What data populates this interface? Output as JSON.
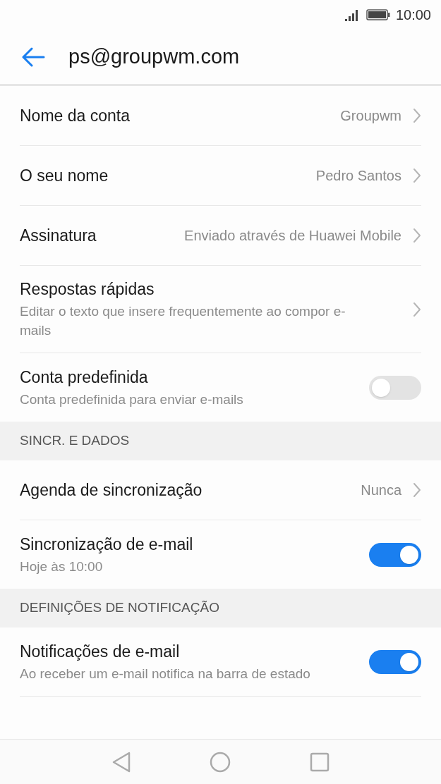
{
  "status_bar": {
    "time": "10:00"
  },
  "header": {
    "title": "ps@groupwm.com"
  },
  "sections": [
    {
      "items": [
        {
          "kind": "chevron",
          "title": "Nome da conta",
          "value": "Groupwm"
        },
        {
          "kind": "chevron",
          "title": "O seu nome",
          "value": "Pedro Santos"
        },
        {
          "kind": "chevron",
          "title": "Assinatura",
          "value": "Enviado através de Huawei Mobile"
        },
        {
          "kind": "chevron",
          "title": "Respostas rápidas",
          "subtitle": "Editar o texto que insere frequentemente ao compor e-mails"
        },
        {
          "kind": "switch",
          "title": "Conta predefinida",
          "subtitle": "Conta predefinida para enviar e-mails",
          "on": false
        }
      ]
    },
    {
      "heading": "SINCR. E DADOS",
      "items": [
        {
          "kind": "chevron",
          "title": "Agenda de sincronização",
          "value": "Nunca"
        },
        {
          "kind": "switch",
          "title": "Sincronização de e-mail",
          "subtitle": "Hoje às 10:00",
          "on": true
        }
      ]
    },
    {
      "heading": "DEFINIÇÕES DE NOTIFICAÇÃO",
      "items": [
        {
          "kind": "switch",
          "title": "Notificações de e-mail",
          "subtitle": "Ao receber um e-mail notifica na barra de estado",
          "on": true
        }
      ]
    }
  ]
}
